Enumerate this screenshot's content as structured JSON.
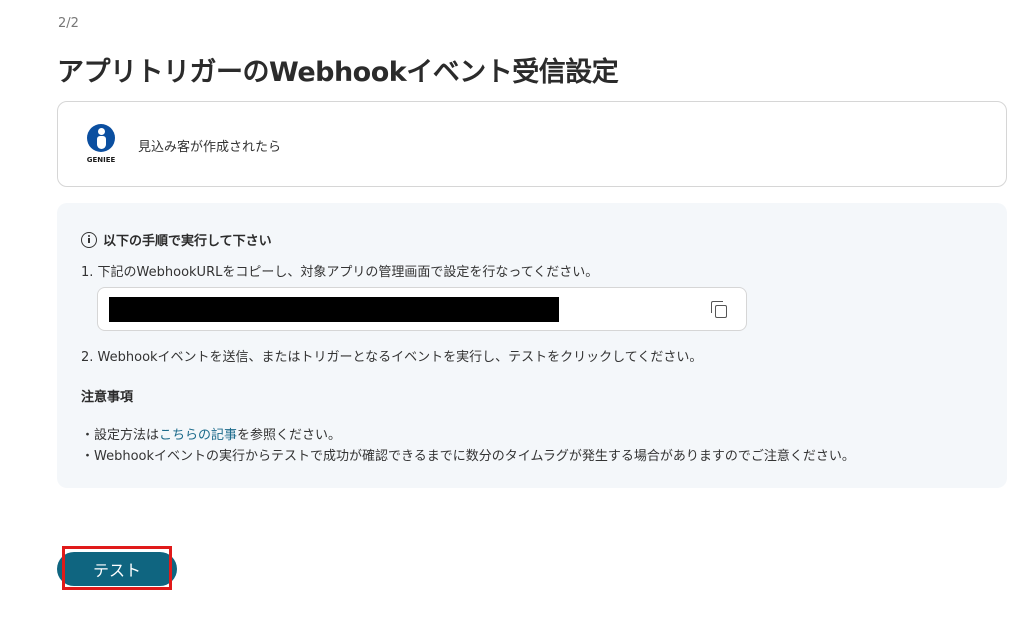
{
  "header": {
    "step": "2/2",
    "title": "アプリトリガーのWebhookイベント受信設定"
  },
  "trigger": {
    "logo_text": "GENIEE",
    "label": "見込み客が作成されたら"
  },
  "instructions": {
    "heading": "以下の手順で実行して下さい",
    "step1": "1. 下記のWebhookURLをコピーし、対象アプリの管理画面で設定を行なってください。",
    "step2": "2. Webhookイベントを送信、またはトリガーとなるイベントを実行し、テストをクリックしてください。",
    "notes_title": "注意事項",
    "note1_prefix": "・設定方法は",
    "note1_link": "こちらの記事",
    "note1_suffix": "を参照ください。",
    "note2": "・Webhookイベントの実行からテストで成功が確認できるまでに数分のタイムラグが発生する場合がありますのでご注意ください。"
  },
  "actions": {
    "test_label": "テスト"
  },
  "colors": {
    "primary_button": "#0f6580",
    "highlight": "#e01a1a",
    "link": "#1b6a8a"
  }
}
